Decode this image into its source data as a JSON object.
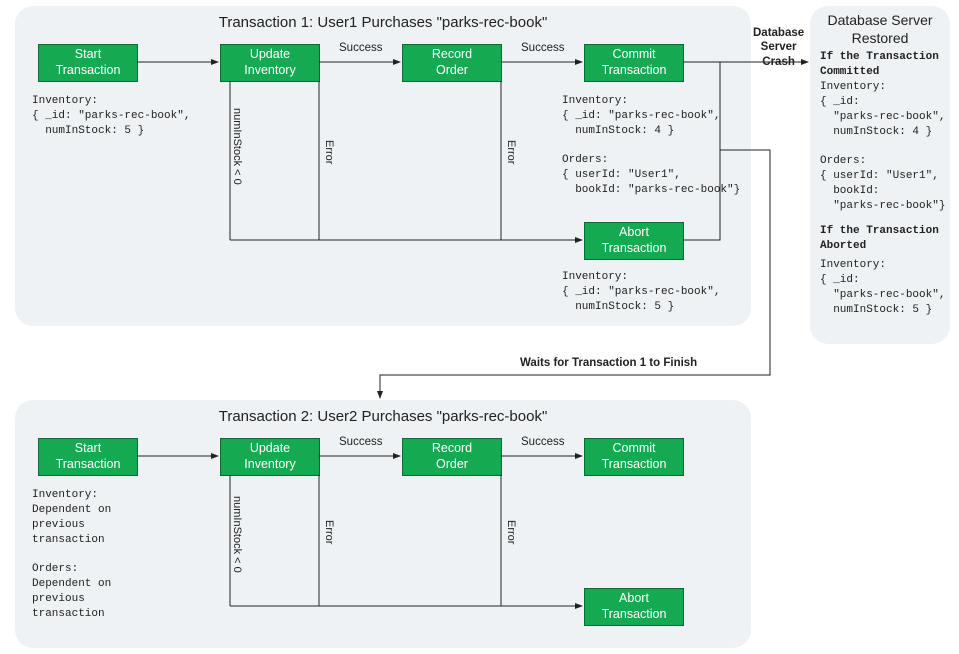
{
  "transaction1": {
    "title": "Transaction 1: User1 Purchases \"parks-rec-book\"",
    "start": "Start\nTransaction",
    "update": "Update\nInventory",
    "record": "Record\nOrder",
    "commit": "Commit\nTransaction",
    "abort": "Abort\nTransaction",
    "success1": "Success",
    "success2": "Success",
    "error1": "Error",
    "error2": "Error",
    "stockCond": "numInStock < 0",
    "inv_before": "Inventory:\n{ _id: \"parks-rec-book\",\n  numInStock: 5 }",
    "inv_commit": "Inventory:\n{ _id: \"parks-rec-book\",\n  numInStock: 4 }\n\nOrders:\n{ userId: \"User1\",\n  bookId: \"parks-rec-book\"}",
    "inv_abort": "Inventory:\n{ _id: \"parks-rec-book\",\n  numInStock: 5 }"
  },
  "crash": "Database\nServer\nCrash",
  "restored": {
    "title": "Database Server\nRestored",
    "h1": "If the Transaction\nCommitted",
    "b1": "Inventory:\n{ _id:\n  \"parks-rec-book\",\n  numInStock: 4 }\n\nOrders:\n{ userId: \"User1\",\n  bookId:\n  \"parks-rec-book\"}",
    "h2": "If the Transaction\nAborted",
    "b2": "Inventory:\n{ _id:\n  \"parks-rec-book\",\n  numInStock: 5 }"
  },
  "wait": "Waits for Transaction 1 to Finish",
  "transaction2": {
    "title": "Transaction 2: User2 Purchases \"parks-rec-book\"",
    "start": "Start\nTransaction",
    "update": "Update\nInventory",
    "record": "Record\nOrder",
    "commit": "Commit\nTransaction",
    "abort": "Abort\nTransaction",
    "success1": "Success",
    "success2": "Success",
    "error1": "Error",
    "error2": "Error",
    "stockCond": "numInStock < 0",
    "note": "Inventory:\nDependent on\nprevious\ntransaction\n\nOrders:\nDependent on\nprevious\ntransaction"
  }
}
